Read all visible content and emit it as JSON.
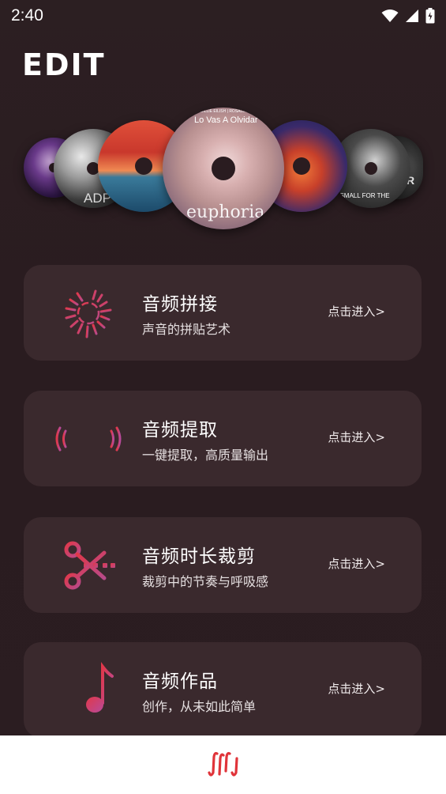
{
  "status_bar": {
    "time": "2:40",
    "icons": [
      "wifi-icon",
      "cellular-signal-icon",
      "battery-icon"
    ]
  },
  "page_title": "EDIT",
  "albums": [
    {
      "name": "album-disc-1"
    },
    {
      "name": "album-disc-2",
      "cover_text": "ADP"
    },
    {
      "name": "album-disc-3"
    },
    {
      "name": "album-disc-euphoria",
      "header_text": "BILLIE EILISH | ROSALÍA",
      "title_text": "Lo Vas A Olvidar",
      "cover_text": "euphoria"
    },
    {
      "name": "album-disc-5"
    },
    {
      "name": "album-disc-6",
      "cover_text": "O SMALL FOR THE"
    },
    {
      "name": "album-disc-7",
      "cover_text": "STAR"
    }
  ],
  "cards": [
    {
      "title": "音频拼接",
      "subtitle": "声音的拼贴艺术",
      "action": "点击进入>",
      "icon": "audio-splice-icon"
    },
    {
      "title": "音频提取",
      "subtitle": "一键提取，高质量输出",
      "action": "点击进入>",
      "icon": "audio-extract-icon"
    },
    {
      "title": "音频时长裁剪",
      "subtitle": "裁剪中的节奏与呼吸感",
      "action": "点击进入>",
      "icon": "scissors-icon"
    },
    {
      "title": "音频作品",
      "subtitle": "创作，从未如此简单",
      "action": "点击进入>",
      "icon": "music-note-list-icon"
    }
  ],
  "bottom_nav": {
    "icon": "app-logo-icon"
  },
  "colors": {
    "background": "#2a1c20",
    "card": "#3a292d",
    "accent_red": "#d8344a",
    "accent_pink": "#c04a86",
    "bottom_bar": "#ffffff"
  }
}
